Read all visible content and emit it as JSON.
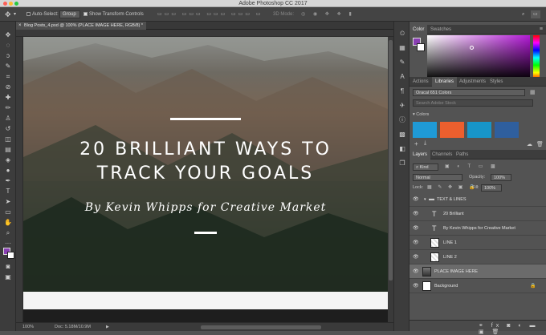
{
  "window": {
    "title": "Adobe Photoshop CC 2017"
  },
  "options_bar": {
    "auto_select_label": "Auto-Select:",
    "auto_select_value": "Group",
    "transform_label": "Show Transform Controls",
    "mode_3d": "3D Mode:"
  },
  "document": {
    "tab_title": "Blog Posts_4.psd @ 100% (PLACE IMAGE HERE, RGB/8) *",
    "zoom": "100%",
    "doc_size": "Doc: 5.18M/10.9M"
  },
  "canvas": {
    "headline_line1": "20 BRILLIANT WAYS TO",
    "headline_line2": "TRACK YOUR GOALS",
    "byline": "By Kevin Whipps for Creative Market"
  },
  "color_panel": {
    "tabs": [
      "Color",
      "Swatches"
    ],
    "active_tab": "Color",
    "foreground_color": "#8a3fb3"
  },
  "libraries_panel": {
    "tabs": [
      "Actions",
      "Libraries",
      "Adjustments",
      "Styles"
    ],
    "active_tab": "Libraries",
    "library_select": "Oracal 651 Colors",
    "search_placeholder": "Search Adobe Stock",
    "section_label": "Colors",
    "colors": [
      "#1f9ad6",
      "#ec5f2e",
      "#1795c9",
      "#2f5f9e"
    ]
  },
  "layers_panel": {
    "tabs": [
      "Layers",
      "Channels",
      "Paths"
    ],
    "active_tab": "Layers",
    "filter_kind": "Kind",
    "blend_mode": "Normal",
    "opacity_label": "Opacity:",
    "opacity_value": "100%",
    "lock_label": "Lock:",
    "fill_label": "Fill:",
    "fill_value": "100%",
    "layers": [
      {
        "name": "TEXT & LINES",
        "kind": "group"
      },
      {
        "name": "20 Brilliant",
        "kind": "text"
      },
      {
        "name": "By Kevin Whipps for Creative Market",
        "kind": "text"
      },
      {
        "name": "LINE 1",
        "kind": "shape"
      },
      {
        "name": "LINE 2",
        "kind": "shape"
      },
      {
        "name": "PLACE IMAGE HERE",
        "kind": "image",
        "selected": true
      },
      {
        "name": "Background",
        "kind": "background"
      }
    ]
  }
}
